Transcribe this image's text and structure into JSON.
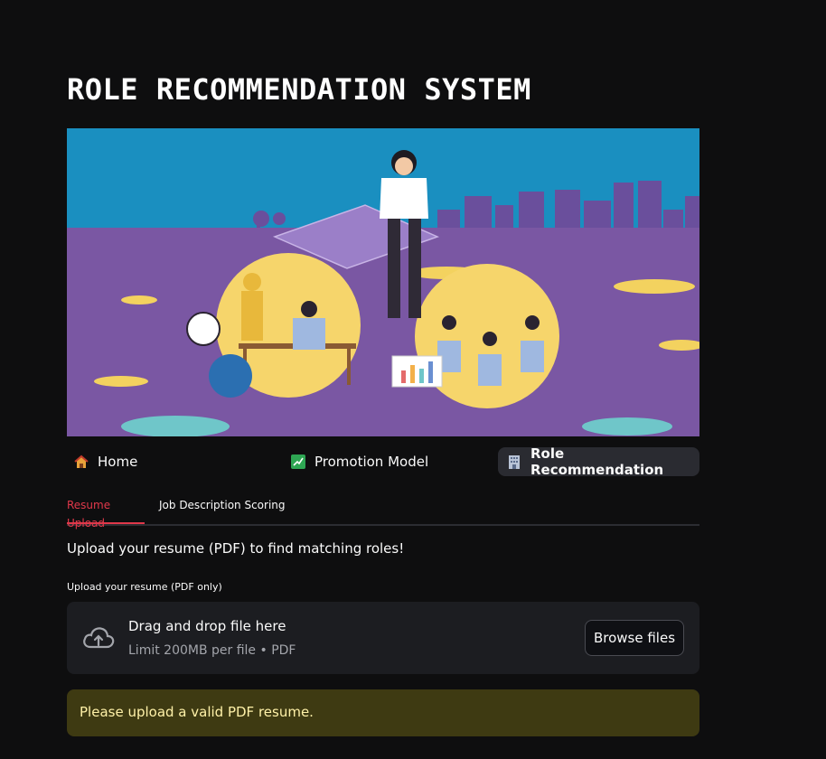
{
  "page": {
    "title": "ROLE RECOMMENDATION SYSTEM"
  },
  "hero": {
    "alt": "Illustration of a manager presenting a plan over a city skyline with teams working at desks"
  },
  "nav": {
    "items": [
      {
        "label": "Home",
        "icon": "house-icon"
      },
      {
        "label": "Promotion Model",
        "icon": "chart-increasing-icon"
      },
      {
        "label": "Role Recommendation",
        "icon": "office-building-icon",
        "active": true
      }
    ]
  },
  "tabs": [
    {
      "label": "Resume Upload",
      "active": true
    },
    {
      "label": "Job Description Scoring",
      "active": false
    }
  ],
  "main": {
    "prompt": "Upload your resume (PDF) to find matching roles!",
    "upload_label": "Upload your resume (PDF only)",
    "dropzone": {
      "title": "Drag and drop file here",
      "subtitle": "Limit 200MB per file • PDF",
      "button": "Browse files",
      "icon": "cloud-upload-icon"
    },
    "warning": "Please upload a valid PDF resume."
  },
  "colors": {
    "background": "#0e0e0f",
    "accent": "#e0384a",
    "warning_bg": "#3e3a12",
    "warning_text": "#fff1a8"
  }
}
